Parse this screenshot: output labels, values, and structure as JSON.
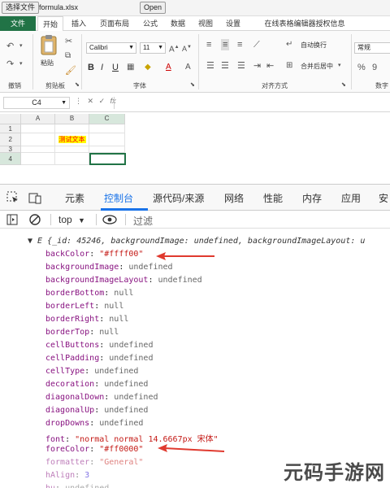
{
  "file_bar": {
    "choose_file": "选择文件",
    "file_name": "formula.xlsx",
    "open": "Open"
  },
  "ribbon_tabs": [
    "文件",
    "开始",
    "插入",
    "页面布局",
    "公式",
    "数据",
    "视图",
    "设置",
    "在线表格编辑器授权信息"
  ],
  "ribbon": {
    "paste": "粘贴",
    "font_name": "Calibri",
    "font_size": "11",
    "wrap_text": "自动换行",
    "merge_center": "合并后居中",
    "number_format": "常规",
    "groups": [
      "撤销",
      "剪贴板",
      "字体",
      "对齐方式",
      "数字"
    ]
  },
  "formula_bar": {
    "cell_ref": "C4",
    "fx": "fx"
  },
  "grid": {
    "columns": [
      "A",
      "B",
      "C"
    ],
    "rows": [
      "1",
      "2",
      "3",
      "4"
    ],
    "cell_B2": "测试文本"
  },
  "devtools": {
    "tabs": [
      "元素",
      "控制台",
      "源代码/来源",
      "网络",
      "性能",
      "内存",
      "应用",
      "安"
    ],
    "active_tab": "控制台",
    "context": "top",
    "filter_placeholder": "过滤",
    "object_head": "▼ E {_id: 45246, backgroundImage: undefined, backgroundImageLayout: u",
    "props": [
      {
        "key": "backColor",
        "value": "\"#ffff00\"",
        "type": "str"
      },
      {
        "key": "backgroundImage",
        "value": "undefined",
        "type": "kw"
      },
      {
        "key": "backgroundImageLayout",
        "value": "undefined",
        "type": "kw"
      },
      {
        "key": "borderBottom",
        "value": "null",
        "type": "kw"
      },
      {
        "key": "borderLeft",
        "value": "null",
        "type": "kw"
      },
      {
        "key": "borderRight",
        "value": "null",
        "type": "kw"
      },
      {
        "key": "borderTop",
        "value": "null",
        "type": "kw"
      },
      {
        "key": "cellButtons",
        "value": "undefined",
        "type": "kw"
      },
      {
        "key": "cellPadding",
        "value": "undefined",
        "type": "kw"
      },
      {
        "key": "cellType",
        "value": "undefined",
        "type": "kw"
      },
      {
        "key": "decoration",
        "value": "undefined",
        "type": "kw"
      },
      {
        "key": "diagonalDown",
        "value": "undefined",
        "type": "kw"
      },
      {
        "key": "diagonalUp",
        "value": "undefined",
        "type": "kw"
      },
      {
        "key": "dropDowns",
        "value": "undefined",
        "type": "kw"
      },
      {
        "key": "font",
        "value": "\"normal normal 14.6667px 宋体\"",
        "type": "str"
      },
      {
        "key": "foreColor",
        "value": "\"#ff0000\"",
        "type": "str"
      },
      {
        "key": "formatter",
        "value": "\"General\"",
        "type": "str",
        "dim": true
      },
      {
        "key": "hAlign",
        "value": "3",
        "type": "num",
        "dim": true
      },
      {
        "key": "hu",
        "value": "undefined",
        "type": "kw",
        "dim": true
      }
    ]
  },
  "colors": {
    "accent": "#217346",
    "arrow": "#e03a2f",
    "highlight_bg": "#ffff00",
    "highlight_fg": "#ff0000",
    "devtools_active": "#1a73e8"
  },
  "watermark": "元码手游网"
}
